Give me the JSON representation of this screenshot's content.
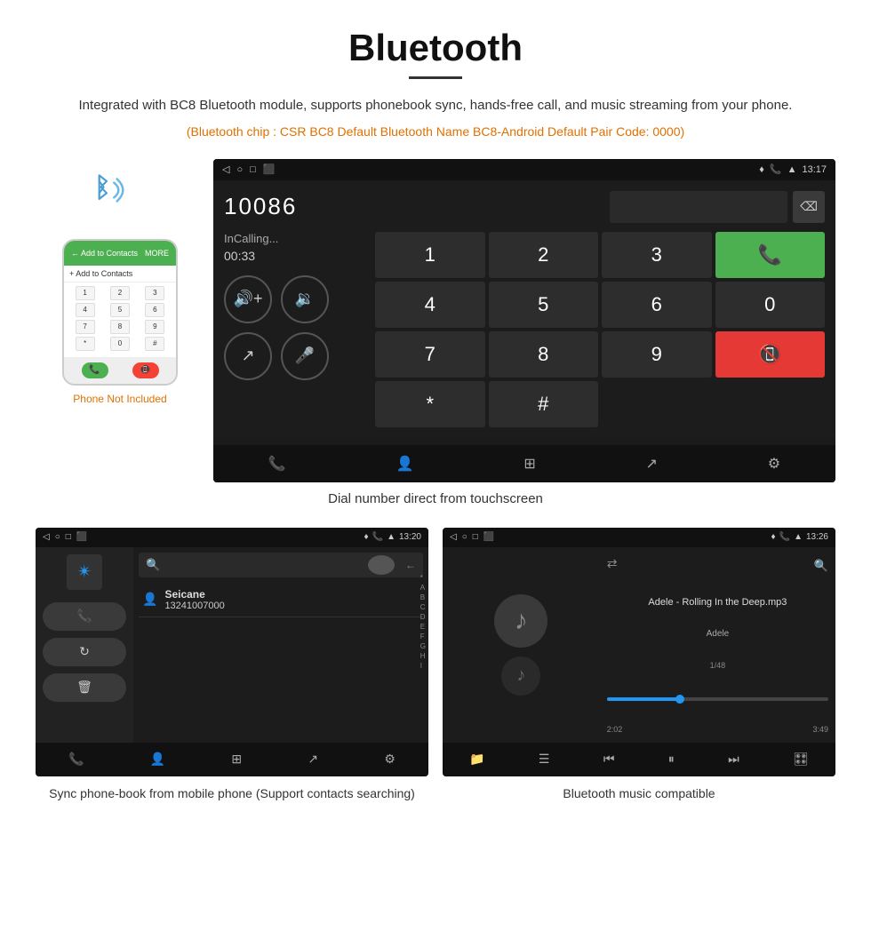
{
  "page": {
    "title": "Bluetooth",
    "description": "Integrated with BC8 Bluetooth module, supports phonebook sync, hands-free call, and music streaming from your phone.",
    "orange_text": "(Bluetooth chip : CSR BC8    Default Bluetooth Name BC8-Android    Default Pair Code: 0000)",
    "caption_dial": "Dial number direct from touchscreen",
    "caption_phonebook": "Sync phone-book from mobile phone (Support contacts searching)",
    "caption_music": "Bluetooth music compatible",
    "phone_not_included": "Phone Not Included"
  },
  "dialer": {
    "time": "13:17",
    "number": "10086",
    "calling_status": "InCalling...",
    "timer": "00:33",
    "keys": [
      "1",
      "2",
      "3",
      "*",
      "4",
      "5",
      "6",
      "0",
      "7",
      "8",
      "9",
      "#"
    ]
  },
  "phonebook": {
    "time": "13:20",
    "contact_name": "Seicane",
    "contact_number": "13241007000",
    "alpha_letters": [
      "*",
      "A",
      "B",
      "C",
      "D",
      "E",
      "F",
      "G",
      "H",
      "I"
    ]
  },
  "music": {
    "time": "13:26",
    "song_title": "Adele - Rolling In the Deep.mp3",
    "artist": "Adele",
    "track_count": "1/48",
    "time_elapsed": "2:02",
    "time_total": "3:49",
    "progress_percent": 33
  }
}
